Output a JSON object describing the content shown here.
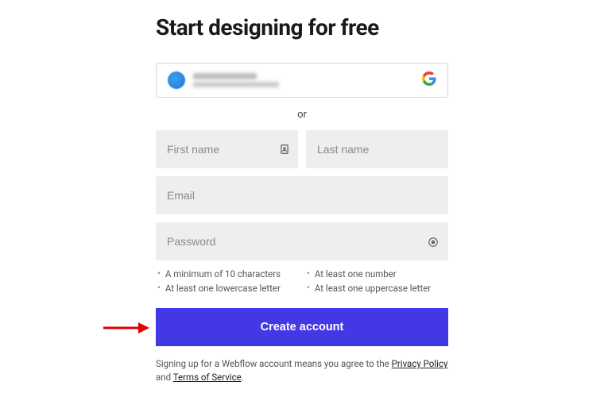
{
  "title": "Start designing for free",
  "or_text": "or",
  "fields": {
    "first_name_placeholder": "First name",
    "last_name_placeholder": "Last name",
    "email_placeholder": "Email",
    "password_placeholder": "Password"
  },
  "password_rules": {
    "min_chars": "A minimum of 10 characters",
    "one_number": "At least one number",
    "one_lower": "At least one lowercase letter",
    "one_upper": "At least one uppercase letter"
  },
  "create_button": "Create account",
  "legal": {
    "prefix": "Signing up for a Webflow account means you agree to the ",
    "privacy": "Privacy Policy",
    "and": " and ",
    "tos": "Terms of Service",
    "suffix": "."
  }
}
